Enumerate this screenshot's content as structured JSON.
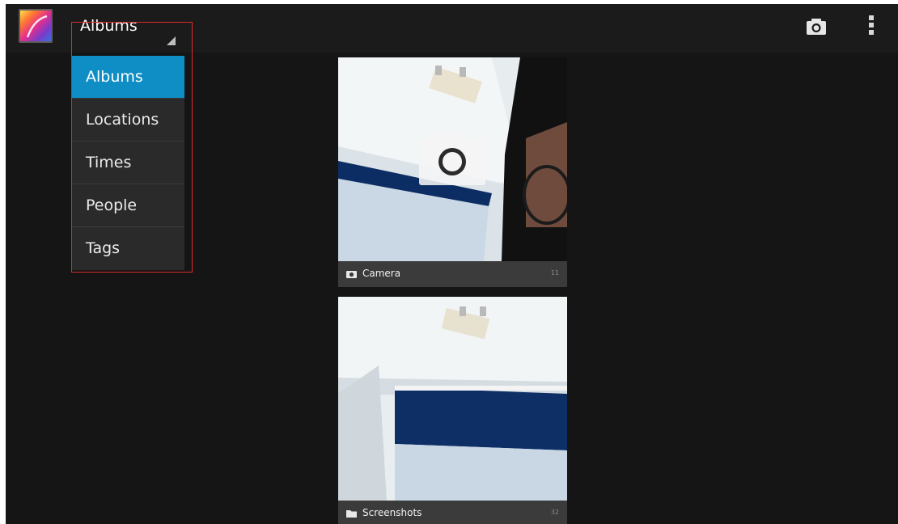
{
  "actionbar": {
    "app_icon": "gallery-app-icon",
    "spinner_label": "Albums",
    "actions": [
      {
        "name": "camera-icon"
      },
      {
        "name": "overflow-menu-icon"
      }
    ]
  },
  "view_menu": {
    "selected": "Albums",
    "items": [
      {
        "label": "Albums"
      },
      {
        "label": "Locations"
      },
      {
        "label": "Times"
      },
      {
        "label": "People"
      },
      {
        "label": "Tags"
      }
    ]
  },
  "albums": [
    {
      "name": "Camera",
      "icon": "camera-icon",
      "count": "11"
    },
    {
      "name": "Screenshots",
      "icon": "folder-icon",
      "count": "32"
    }
  ],
  "colors": {
    "background": "#151515",
    "actionbar": "#1b1b1b",
    "menu_background": "#2a2a2a",
    "menu_selected": "#0e8ec5",
    "highlight_border": "#dd2b2b",
    "caption_bar": "#3b3b3b"
  }
}
